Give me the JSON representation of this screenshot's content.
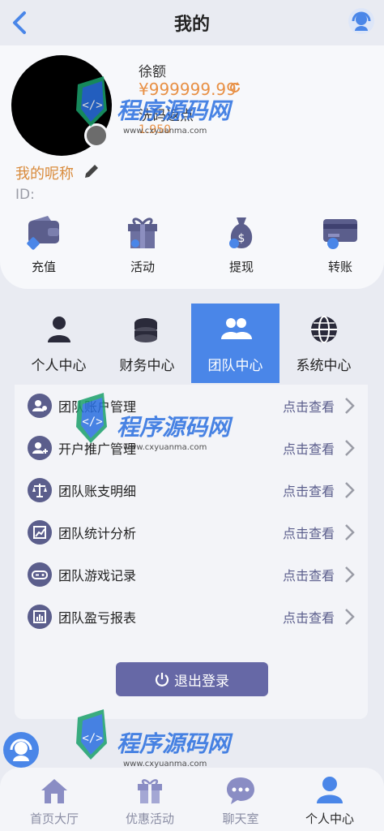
{
  "header": {
    "title": "我的"
  },
  "profile": {
    "balance_label": "徐额",
    "balance_value": "¥999999.99",
    "rebate_label": "洗码返点",
    "rebate_value": "1.950",
    "nickname": "我的呢称",
    "id_label": "ID:"
  },
  "actions": [
    {
      "label": "充值",
      "icon": "wallet-icon"
    },
    {
      "label": "活动",
      "icon": "gift-icon"
    },
    {
      "label": "提现",
      "icon": "money-bag-icon"
    },
    {
      "label": "转账",
      "icon": "card-transfer-icon"
    }
  ],
  "tabs": [
    {
      "label": "个人中心",
      "icon": "person-icon"
    },
    {
      "label": "财务中心",
      "icon": "coins-icon"
    },
    {
      "label": "团队中心",
      "icon": "team-icon",
      "active": true
    },
    {
      "label": "系统中心",
      "icon": "globe-icon"
    }
  ],
  "menu": {
    "action_label": "点击查看",
    "items": [
      {
        "label": "团队账户管理",
        "icon": "team-user-icon"
      },
      {
        "label": "开户推广管理",
        "icon": "user-add-icon"
      },
      {
        "label": "团队账支明细",
        "icon": "scale-icon"
      },
      {
        "label": "团队统计分析",
        "icon": "chart-icon"
      },
      {
        "label": "团队游戏记录",
        "icon": "gamepad-icon"
      },
      {
        "label": "团队盈亏报表",
        "icon": "report-icon"
      }
    ]
  },
  "logout_label": "退出登录",
  "watermark": {
    "text": "程序源码网",
    "url": "www.cxyuanma.com"
  },
  "bottom_nav": [
    {
      "label": "首页大厅",
      "icon": "home-icon"
    },
    {
      "label": "优惠活动",
      "icon": "gift-icon"
    },
    {
      "label": "聊天室",
      "icon": "chat-icon"
    },
    {
      "label": "个人中心",
      "icon": "person-icon",
      "active": true
    }
  ],
  "colors": {
    "accent": "#4a86e8",
    "gold": "#e89045",
    "menu_icon": "#5b5e8c",
    "logout": "#6668a6"
  }
}
